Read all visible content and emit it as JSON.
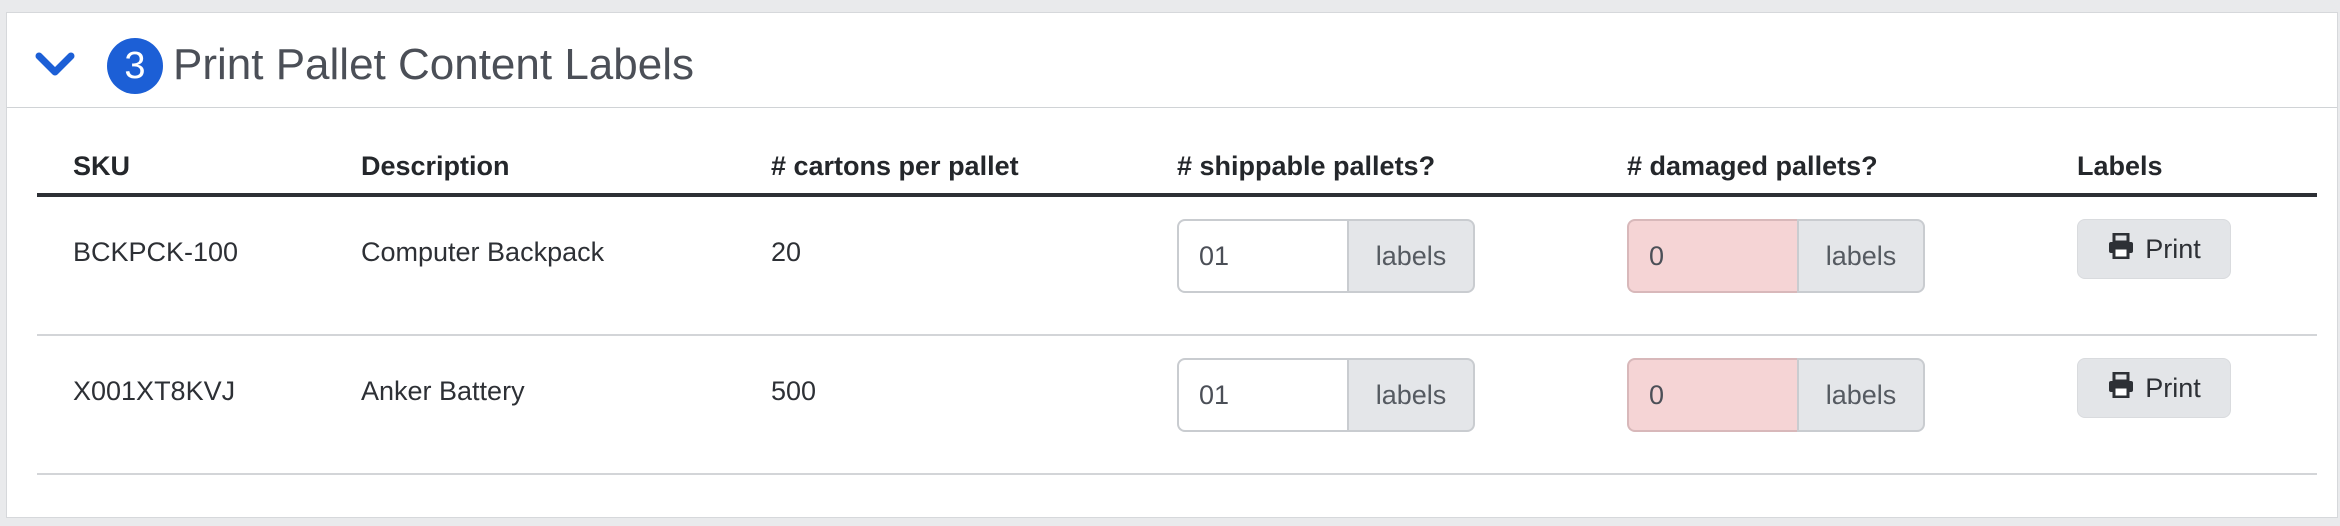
{
  "section": {
    "step_number": "3",
    "title": "Print Pallet Content Labels"
  },
  "icons": {
    "collapse": "chevron-down-icon",
    "print": "printer-icon"
  },
  "colors": {
    "accent": "#1c5fd6",
    "invalid_input_bg": "#f5d4d5",
    "addon_bg": "#e4e6e9"
  },
  "table": {
    "headers": [
      "SKU",
      "Description",
      "# cartons per pallet",
      "# shippable pallets?",
      "# damaged pallets?",
      "Labels"
    ],
    "rows": [
      {
        "sku": "BCKPCK-100",
        "description": "Computer Backpack",
        "cartons": "20",
        "shippable_value": "01",
        "shippable_addon": "labels",
        "damaged_value": "0",
        "damaged_addon": "labels",
        "print_label": "Print"
      },
      {
        "sku": "X001XT8KVJ",
        "description": "Anker Battery",
        "cartons": "500",
        "shippable_value": "01",
        "shippable_addon": "labels",
        "damaged_value": "0",
        "damaged_addon": "labels",
        "print_label": "Print"
      }
    ]
  }
}
